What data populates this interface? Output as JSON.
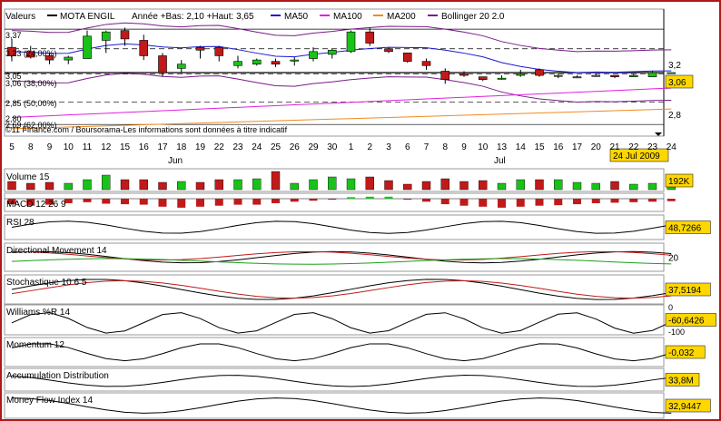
{
  "legend": {
    "valeurs": "Valeurs",
    "series_name": "MOTA ENGIL",
    "year_range": "Année +Bas: 2,10 +Haut: 3,65",
    "ma50": "MA50",
    "ma100": "MA100",
    "ma200": "MA200",
    "bollinger": "Bollinger 20 2.0"
  },
  "colors": {
    "up": "#19c219",
    "down": "#c01a1a",
    "ma50": "#1a1ad0",
    "ma100": "#e020e0",
    "ma200": "#f08a20",
    "bollinger": "#7a1a8a",
    "value_box": "#ffd700",
    "frame": "#b01818"
  },
  "price_panel": {
    "fib_labels": [
      "3,37",
      "3,23 (24,00%)",
      "3,05",
      "3,06 (38,00%)",
      "2,85 (50,00%)",
      "2,80",
      "2,69 (62,00%)"
    ],
    "right_ticks": [
      "3,2",
      "2,8"
    ],
    "last_value": "3,06",
    "watermark": "©11 Finance.com / Boursorama-Les informations sont données à titre indicatif",
    "date_box": "24 Jul 2009",
    "months": [
      "Jun",
      "Jul"
    ]
  },
  "chart_data": {
    "type": "candlestick",
    "x": [
      "5",
      "8",
      "9",
      "10",
      "11",
      "12",
      "15",
      "16",
      "17",
      "18",
      "19",
      "22",
      "23",
      "24",
      "25",
      "26",
      "29",
      "30",
      "1",
      "2",
      "3",
      "6",
      "7",
      "8",
      "9",
      "10",
      "13",
      "14",
      "15",
      "16",
      "17",
      "20",
      "21",
      "22",
      "23",
      "24"
    ],
    "ohlc": [
      [
        3.24,
        3.3,
        3.14,
        3.18
      ],
      [
        3.21,
        3.25,
        3.16,
        3.17
      ],
      [
        3.18,
        3.2,
        3.12,
        3.15
      ],
      [
        3.15,
        3.18,
        3.12,
        3.17
      ],
      [
        3.16,
        3.36,
        3.16,
        3.32
      ],
      [
        3.29,
        3.36,
        3.2,
        3.35
      ],
      [
        3.36,
        3.38,
        3.25,
        3.3
      ],
      [
        3.29,
        3.33,
        3.15,
        3.18
      ],
      [
        3.18,
        3.2,
        3.03,
        3.06
      ],
      [
        3.09,
        3.15,
        3.06,
        3.12
      ],
      [
        3.24,
        3.25,
        3.16,
        3.22
      ],
      [
        3.24,
        3.25,
        3.14,
        3.18
      ],
      [
        3.11,
        3.18,
        3.09,
        3.14
      ],
      [
        3.12,
        3.16,
        3.11,
        3.15
      ],
      [
        3.14,
        3.16,
        3.1,
        3.12
      ],
      [
        3.15,
        3.17,
        3.11,
        3.15
      ],
      [
        3.16,
        3.24,
        3.14,
        3.21
      ],
      [
        3.19,
        3.23,
        3.16,
        3.22
      ],
      [
        3.21,
        3.36,
        3.2,
        3.35
      ],
      [
        3.35,
        3.38,
        3.25,
        3.27
      ],
      [
        3.23,
        3.24,
        3.2,
        3.21
      ],
      [
        3.2,
        3.2,
        3.13,
        3.14
      ],
      [
        3.14,
        3.16,
        3.08,
        3.11
      ],
      [
        3.07,
        3.09,
        2.98,
        3.01
      ],
      [
        3.05,
        3.07,
        3.03,
        3.04
      ],
      [
        3.03,
        3.03,
        3.0,
        3.01
      ],
      [
        3.02,
        3.04,
        3.01,
        3.02
      ],
      [
        3.04,
        3.08,
        3.03,
        3.05
      ],
      [
        3.08,
        3.09,
        3.03,
        3.04
      ],
      [
        3.04,
        3.05,
        3.02,
        3.04
      ],
      [
        3.03,
        3.04,
        3.02,
        3.03
      ],
      [
        3.04,
        3.05,
        3.03,
        3.04
      ],
      [
        3.04,
        3.04,
        3.02,
        3.03
      ],
      [
        3.03,
        3.05,
        3.03,
        3.04
      ],
      [
        3.03,
        3.07,
        3.03,
        3.06
      ],
      [
        3.06,
        3.06,
        3.06,
        3.06
      ]
    ],
    "ylim": [
      2.62,
      3.5
    ]
  },
  "volume_panel": {
    "label": "Volume 15",
    "value": "192K",
    "bars": [
      0.45,
      0.35,
      0.4,
      0.35,
      0.55,
      0.8,
      0.55,
      0.55,
      0.4,
      0.45,
      0.4,
      0.55,
      0.55,
      0.6,
      1.0,
      0.35,
      0.55,
      0.7,
      0.6,
      0.7,
      0.5,
      0.3,
      0.45,
      0.6,
      0.45,
      0.5,
      0.35,
      0.55,
      0.55,
      0.55,
      0.4,
      0.35,
      0.45,
      0.3,
      0.35,
      0.35
    ]
  },
  "macd_panel": {
    "label": "MACD 12 26 9",
    "bars": [
      -0.55,
      -0.7,
      -0.6,
      -0.45,
      -0.35,
      -0.5,
      -0.55,
      -0.6,
      -0.8,
      -0.9,
      -0.8,
      -0.7,
      -0.6,
      -0.6,
      -0.45,
      -0.3,
      -0.2,
      -0.1,
      0.15,
      0.2,
      0.2,
      -0.1,
      -0.3,
      -0.55,
      -0.7,
      -0.8,
      -0.9,
      -0.8,
      -0.7,
      -0.65,
      -0.55,
      -0.45,
      -0.4,
      -0.35,
      -0.3,
      -0.25
    ]
  },
  "indicators": [
    {
      "label": "RSI 28",
      "value": "48,7266"
    },
    {
      "label": "Directional Movement 14",
      "value": "20"
    },
    {
      "label": "Stochastique 10 6 5",
      "value": "37,5194"
    },
    {
      "label": "Williams %R 14",
      "value": "-60,6426",
      "ticks": [
        "0",
        "-100"
      ]
    },
    {
      "label": "Momentum 12",
      "value": "-0,032"
    },
    {
      "label": "Accumulation Distribution",
      "value": "33,8M"
    },
    {
      "label": "Money Flow Index 14",
      "value": "32,9447"
    }
  ]
}
